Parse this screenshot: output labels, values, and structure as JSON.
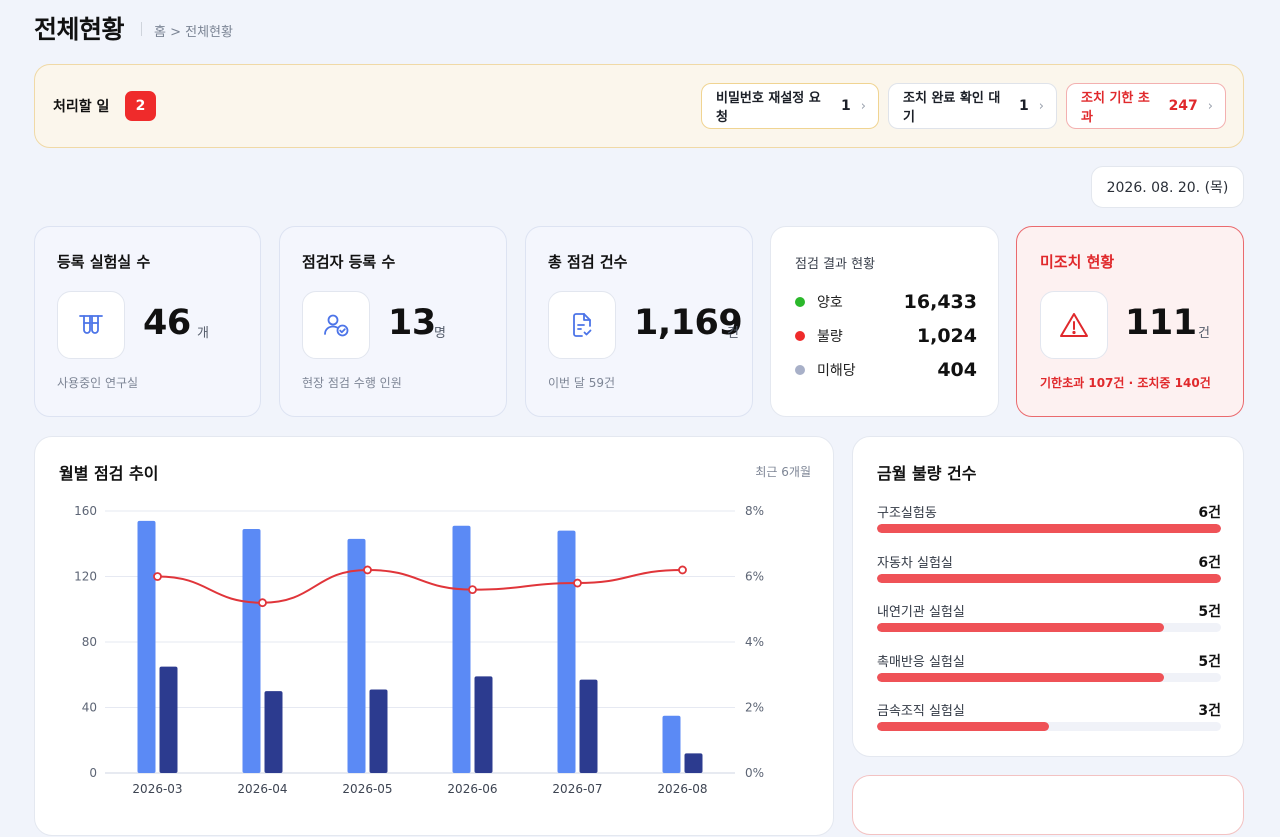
{
  "header": {
    "title": "전체현황",
    "breadcrumb": "홈 > 전체현황"
  },
  "todo": {
    "label": "처리할 일",
    "badge": "2",
    "chips": [
      {
        "label": "비밀번호 재설정 요청",
        "count": "1"
      },
      {
        "label": "조치 완료 확인 대기",
        "count": "1"
      },
      {
        "label": "조치 기한 초과",
        "count": "247"
      }
    ]
  },
  "date": "2026. 08. 20. (목)",
  "stats": [
    {
      "title": "등록 실험실 수",
      "value": "46",
      "unit": "개",
      "sub": "사용중인 연구실",
      "icon": "lab-tubes-icon"
    },
    {
      "title": "점검자 등록 수",
      "value": "13",
      "unit": "명",
      "sub": "현장 점검 수행 인원",
      "icon": "user-check-icon"
    },
    {
      "title": "총 점검 건수",
      "value": "1,169",
      "unit": "건",
      "sub": "이번 달 59건",
      "icon": "document-check-icon"
    }
  ],
  "results": {
    "title": "점검 결과 현황",
    "items": [
      {
        "label": "양호",
        "value": "16,433",
        "color": "#2bb82b"
      },
      {
        "label": "불량",
        "value": "1,024",
        "color": "#ef2b2b"
      },
      {
        "label": "미해당",
        "value": "404",
        "color": "#a8b0c8"
      }
    ]
  },
  "alert": {
    "title": "미조치 현황",
    "value": "111",
    "unit": "건",
    "sub": "기한초과 107건 · 조치중 140건",
    "icon": "warning-icon"
  },
  "chart": {
    "title": "월별 점검 추이",
    "range_label": "최근 6개월"
  },
  "chart_data": {
    "type": "bar",
    "categories": [
      "2026-03",
      "2026-04",
      "2026-05",
      "2026-06",
      "2026-07",
      "2026-08"
    ],
    "series": [
      {
        "kind": "bar",
        "axis": "left",
        "color": "#5b8af5",
        "values": [
          154,
          149,
          143,
          151,
          148,
          35
        ]
      },
      {
        "kind": "bar",
        "axis": "left",
        "color": "#2c3b8f",
        "values": [
          65,
          50,
          51,
          59,
          57,
          12
        ]
      },
      {
        "kind": "line",
        "axis": "right",
        "color": "#e0353a",
        "values": [
          6.0,
          5.2,
          6.2,
          5.6,
          5.8,
          6.2
        ]
      }
    ],
    "y_left": {
      "min": 0,
      "max": 160,
      "ticks": [
        "0",
        "40",
        "80",
        "120",
        "160"
      ]
    },
    "y_right": {
      "min": 0,
      "max": 8,
      "ticks": [
        "0%",
        "2%",
        "4%",
        "6%",
        "8%"
      ]
    },
    "grid": true
  },
  "defects": {
    "title": "금월 불량 건수",
    "max": 6,
    "items": [
      {
        "name": "구조실험동",
        "count_label": "6건",
        "count": 6
      },
      {
        "name": "자동차 실험실",
        "count_label": "6건",
        "count": 6
      },
      {
        "name": "내연기관 실험실",
        "count_label": "5건",
        "count": 5
      },
      {
        "name": "촉매반응 실험실",
        "count_label": "5건",
        "count": 5
      },
      {
        "name": "금속조직 실험실",
        "count_label": "3건",
        "count": 3
      }
    ]
  }
}
